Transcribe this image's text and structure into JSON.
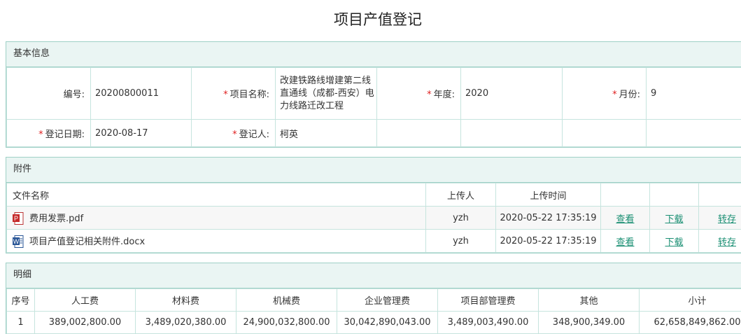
{
  "page": {
    "title": "项目产值登记"
  },
  "basic": {
    "section_title": "基本信息",
    "code_label": "编号:",
    "code_value": "20200800011",
    "project_label": "项目名称:",
    "project_value": "改建铁路线增建第二线直通线（成都-西安）电力线路迁改工程",
    "year_label": "年度:",
    "year_value": "2020",
    "month_label": "月份:",
    "month_value": "9",
    "date_label": "登记日期:",
    "date_value": "2020-08-17",
    "person_label": "登记人:",
    "person_value": "柯英",
    "required_mark": "*"
  },
  "attachments": {
    "section_title": "附件",
    "headers": {
      "name": "文件名称",
      "uploader": "上传人",
      "time": "上传时间"
    },
    "files": [
      {
        "icon": "pdf-file-icon",
        "name": "费用发票.pdf",
        "uploader": "yzh",
        "time": "2020-05-22 17:35:19",
        "view": "查看",
        "download": "下载",
        "transfer": "转存"
      },
      {
        "icon": "word-file-icon",
        "name": "项目产值登记相关附件.docx",
        "uploader": "yzh",
        "time": "2020-05-22 17:35:19",
        "view": "查看",
        "download": "下载",
        "transfer": "转存"
      }
    ]
  },
  "details": {
    "section_title": "明细",
    "headers": [
      "序号",
      "人工费",
      "材料费",
      "机械费",
      "企业管理费",
      "项目部管理费",
      "其他",
      "小计"
    ],
    "rows": [
      [
        "1",
        "389,002,800.00",
        "3,489,020,380.00",
        "24,900,032,800.00",
        "30,042,890,043.00",
        "3,489,003,490.00",
        "348,900,349.00",
        "62,658,849,862.00"
      ]
    ]
  },
  "colors": {
    "accent": "#1a8f73",
    "border": "#9fd0c6",
    "header_bg": "#eaf5f3",
    "required": "#e02020"
  }
}
